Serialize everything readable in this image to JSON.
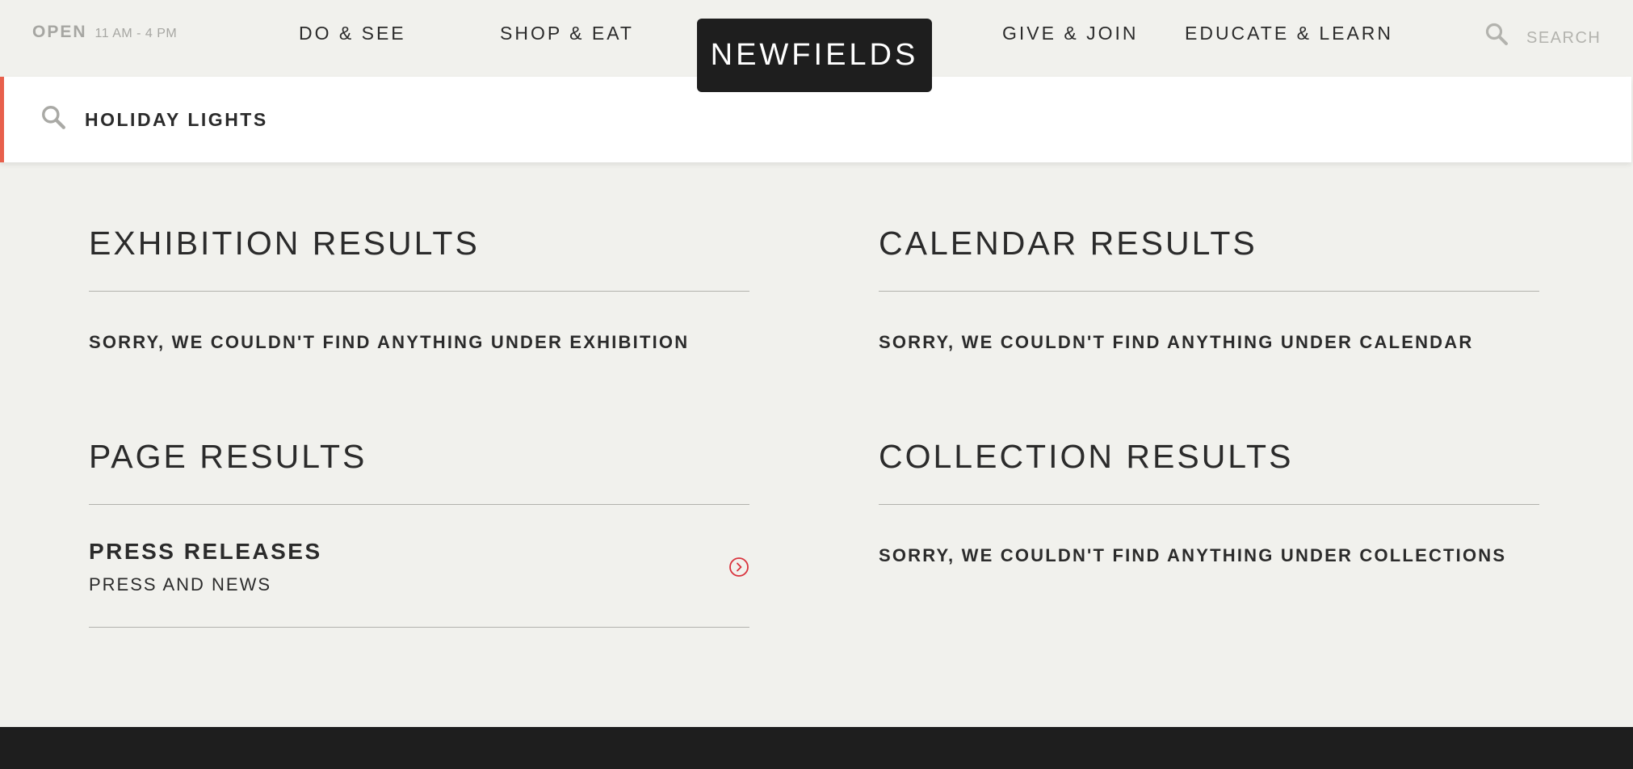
{
  "header": {
    "hours_status": "OPEN",
    "hours_time": "11 AM - 4 PM",
    "nav": {
      "do_see": "DO & SEE",
      "shop_eat": "SHOP & EAT",
      "give_join": "GIVE & JOIN",
      "educate_learn": "EDUCATE & LEARN"
    },
    "logo": "NEWFIELDS",
    "search_label": "SEARCH"
  },
  "search": {
    "value": "HOLIDAY LIGHTS",
    "icon": "search-icon"
  },
  "results": {
    "exhibition": {
      "title": "EXHIBITION RESULTS",
      "empty_message": "SORRY, WE COULDN'T FIND ANYTHING UNDER EXHIBITION"
    },
    "calendar": {
      "title": "CALENDAR RESULTS",
      "empty_message": "SORRY, WE COULDN'T FIND ANYTHING UNDER CALENDAR"
    },
    "page": {
      "title": "PAGE RESULTS",
      "items": [
        {
          "title": "PRESS RELEASES",
          "subtitle": "PRESS AND NEWS",
          "icon": "chevron-right-circle-icon"
        }
      ]
    },
    "collection": {
      "title": "COLLECTION RESULTS",
      "empty_message": "SORRY, WE COULDN'T FIND ANYTHING UNDER COLLECTIONS"
    }
  },
  "colors": {
    "background": "#f1f1ed",
    "text": "#2b2b2b",
    "accent": "#e8604c",
    "arrow": "#d9323c",
    "dark": "#1e1e1e",
    "muted": "#a6a6a2"
  }
}
